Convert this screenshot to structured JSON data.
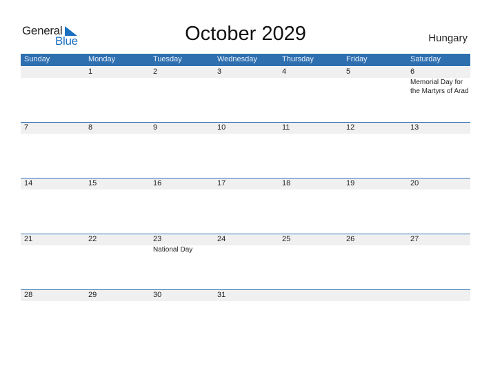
{
  "logo": {
    "line1": "General",
    "line2": "Blue"
  },
  "title": "October 2029",
  "country": "Hungary",
  "colors": {
    "accent": "#2e6fb0",
    "strip": "#f0f0f0"
  },
  "weekdays": [
    "Sunday",
    "Monday",
    "Tuesday",
    "Wednesday",
    "Thursday",
    "Friday",
    "Saturday"
  ],
  "weeks": [
    {
      "days": [
        "",
        "1",
        "2",
        "3",
        "4",
        "5",
        "6"
      ],
      "events": [
        "",
        "",
        "",
        "",
        "",
        "",
        "Memorial Day for the Martyrs of Arad"
      ]
    },
    {
      "days": [
        "7",
        "8",
        "9",
        "10",
        "11",
        "12",
        "13"
      ],
      "events": [
        "",
        "",
        "",
        "",
        "",
        "",
        ""
      ]
    },
    {
      "days": [
        "14",
        "15",
        "16",
        "17",
        "18",
        "19",
        "20"
      ],
      "events": [
        "",
        "",
        "",
        "",
        "",
        "",
        ""
      ]
    },
    {
      "days": [
        "21",
        "22",
        "23",
        "24",
        "25",
        "26",
        "27"
      ],
      "events": [
        "",
        "",
        "National Day",
        "",
        "",
        "",
        ""
      ]
    },
    {
      "days": [
        "28",
        "29",
        "30",
        "31",
        "",
        "",
        ""
      ],
      "events": [
        "",
        "",
        "",
        "",
        "",
        "",
        ""
      ]
    }
  ]
}
